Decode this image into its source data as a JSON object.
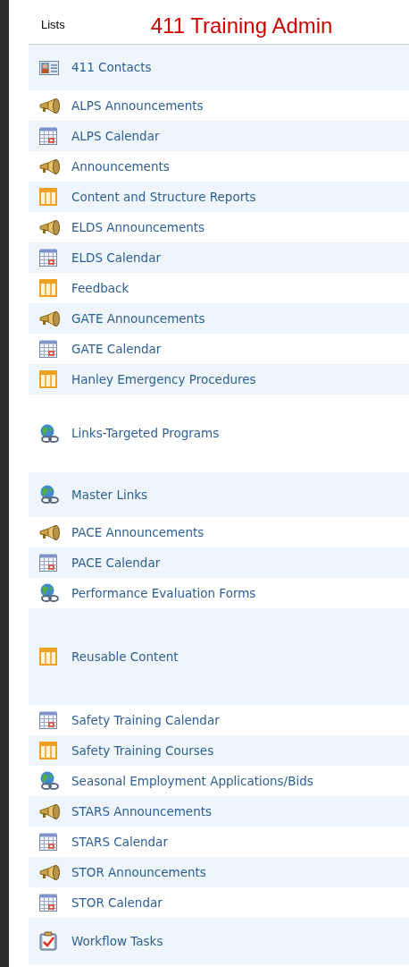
{
  "header": {
    "label": "Lists",
    "title": "411 Training Admin"
  },
  "items": [
    {
      "label": "411 Contacts",
      "kind": "contacts"
    },
    {
      "label": "ALPS Announcements",
      "kind": "announcement"
    },
    {
      "label": "ALPS Calendar",
      "kind": "calendar"
    },
    {
      "label": "Announcements",
      "kind": "announcement"
    },
    {
      "label": "Content and Structure Reports",
      "kind": "list"
    },
    {
      "label": "ELDS Announcements",
      "kind": "announcement"
    },
    {
      "label": "ELDS Calendar",
      "kind": "calendar"
    },
    {
      "label": "Feedback",
      "kind": "list"
    },
    {
      "label": "GATE Announcements",
      "kind": "announcement"
    },
    {
      "label": "GATE Calendar",
      "kind": "calendar"
    },
    {
      "label": "Hanley Emergency Procedures",
      "kind": "list"
    },
    {
      "label": "Links-Targeted Programs",
      "kind": "links"
    },
    {
      "label": "Master Links",
      "kind": "links"
    },
    {
      "label": "PACE Announcements",
      "kind": "announcement"
    },
    {
      "label": "PACE Calendar",
      "kind": "calendar"
    },
    {
      "label": "Performance Evaluation Forms",
      "kind": "links"
    },
    {
      "label": "Reusable Content",
      "kind": "list"
    },
    {
      "label": "Safety Training Calendar",
      "kind": "calendar"
    },
    {
      "label": "Safety Training Courses",
      "kind": "list"
    },
    {
      "label": "Seasonal Employment Applications/Bids",
      "kind": "links"
    },
    {
      "label": "STARS Announcements",
      "kind": "announcement"
    },
    {
      "label": "STARS Calendar",
      "kind": "calendar"
    },
    {
      "label": "STOR Announcements",
      "kind": "announcement"
    },
    {
      "label": "STOR Calendar",
      "kind": "calendar"
    },
    {
      "label": "Workflow Tasks",
      "kind": "tasks"
    }
  ]
}
